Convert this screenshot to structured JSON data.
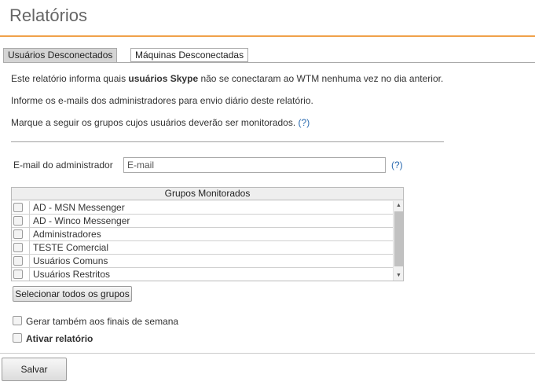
{
  "page": {
    "title": "Relatórios"
  },
  "tabs": [
    {
      "label": "Usuários Desconectados",
      "active": true
    },
    {
      "label": "Máquinas Desconectadas",
      "active": false
    }
  ],
  "intro": {
    "line1_prefix": "Este relatório informa quais ",
    "line1_bold": "usuários Skype",
    "line1_suffix": " não se conectaram ao WTM nenhuma vez no dia anterior.",
    "line2": "Informe os e-mails dos administradores para envio diário deste relatório.",
    "line3": "Marque a seguir os grupos cujos usuários deverão ser monitorados.",
    "help": "(?)"
  },
  "email": {
    "label": "E-mail do administrador",
    "value": "",
    "placeholder": "E-mail",
    "help": "(?)"
  },
  "groups": {
    "header": "Grupos Monitorados",
    "items": [
      {
        "label": "AD - MSN Messenger",
        "checked": false
      },
      {
        "label": "AD - Winco Messenger",
        "checked": false
      },
      {
        "label": "Administradores",
        "checked": false
      },
      {
        "label": "TESTE Comercial",
        "checked": false
      },
      {
        "label": "Usuários Comuns",
        "checked": false
      },
      {
        "label": "Usuários Restritos",
        "checked": false
      }
    ],
    "select_all_label": "Selecionar todos os grupos"
  },
  "options": {
    "weekends": {
      "label": "Gerar também aos finais de semana",
      "checked": false
    },
    "activate": {
      "label": "Ativar relatório",
      "checked": false
    }
  },
  "actions": {
    "save_label": "Salvar"
  },
  "colors": {
    "accent": "#f0a14a",
    "link": "#2a6ab0"
  }
}
